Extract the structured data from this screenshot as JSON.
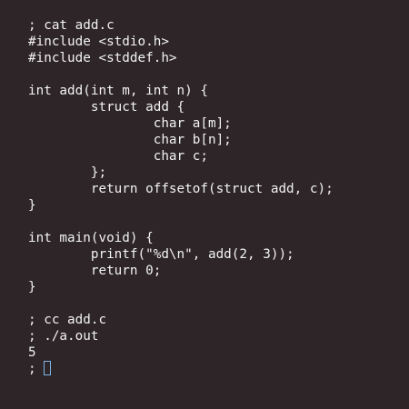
{
  "terminal": {
    "lines": [
      "; cat add.c",
      "#include <stdio.h>",
      "#include <stddef.h>",
      "",
      "int add(int m, int n) {",
      "        struct add {",
      "                char a[m];",
      "                char b[n];",
      "                char c;",
      "        };",
      "        return offsetof(struct add, c);",
      "}",
      "",
      "int main(void) {",
      "        printf(\"%d\\n\", add(2, 3));",
      "        return 0;",
      "}",
      "",
      "; cc add.c",
      "; ./a.out",
      "5"
    ],
    "prompt": "; ",
    "colors": {
      "background": "#2d2527",
      "text": "#f2f2f2",
      "cursor": "#7fb4e6"
    }
  }
}
